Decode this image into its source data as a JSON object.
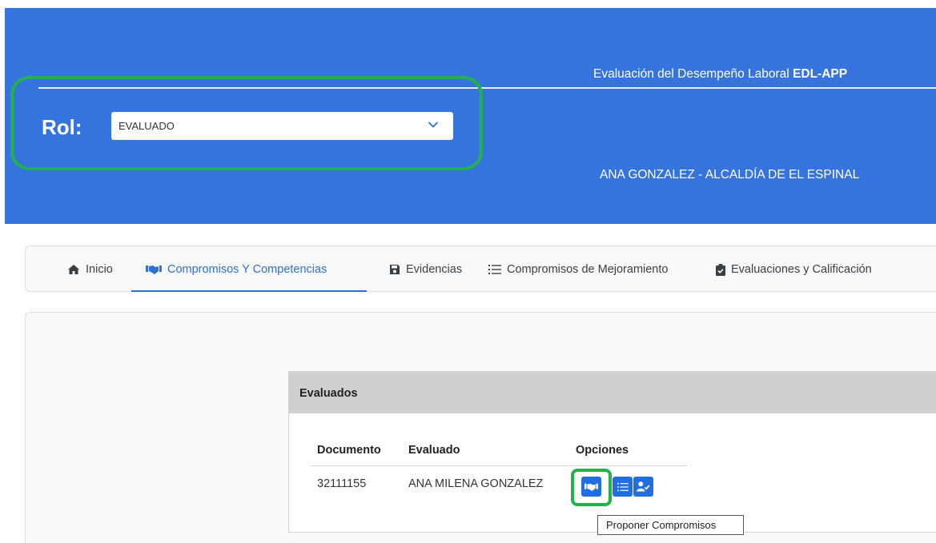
{
  "header": {
    "title_prefix": "Evaluación del Desempeño Laboral",
    "title_bold": "EDL-APP",
    "rol_label": "Rol:",
    "rol_value": "EVALUADO",
    "user_line": "ANA GONZALEZ - ALCALDÍA DE EL ESPINAL"
  },
  "nav": {
    "tabs": [
      {
        "label": "Inicio",
        "icon": "home-icon"
      },
      {
        "label": "Compromisos Y Competencias",
        "icon": "handshake-icon",
        "active": true
      },
      {
        "label": "Evidencias",
        "icon": "save-icon"
      },
      {
        "label": "Compromisos de Mejoramiento",
        "icon": "list-icon"
      },
      {
        "label": "Evaluaciones y Calificación",
        "icon": "clipboard-check-icon"
      }
    ]
  },
  "card": {
    "title": "Evaluados",
    "columns": [
      "Documento",
      "Evaluado",
      "Opciones"
    ],
    "rows": [
      {
        "documento": "32111155",
        "evaluado": "ANA MILENA GONZALEZ",
        "options": [
          "handshake-icon",
          "list-icon",
          "user-check-icon"
        ]
      }
    ]
  },
  "tooltip": "Proponer Compromisos",
  "colors": {
    "header_blue": "#3574dc",
    "active_tab": "#2f6fd6",
    "button_blue": "#1f6fe0",
    "highlight_green": "#22b14c"
  }
}
